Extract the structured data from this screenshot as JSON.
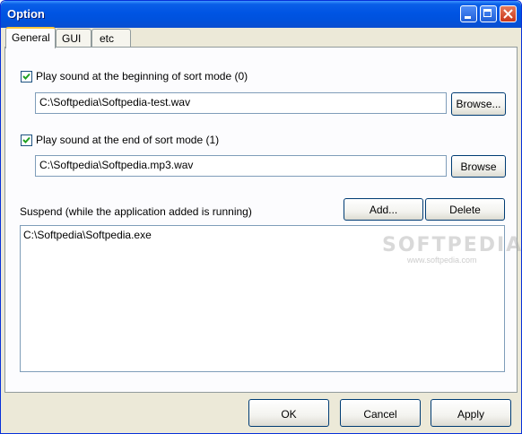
{
  "window": {
    "title": "Option"
  },
  "tabs": [
    {
      "label": "General",
      "active": true
    },
    {
      "label": "GUI",
      "active": false
    },
    {
      "label": "etc",
      "active": false
    }
  ],
  "general": {
    "sound_begin": {
      "checked": true,
      "label": "Play sound at the beginning of sort mode (0)",
      "path": "C:\\Softpedia\\Softpedia-test.wav",
      "browse_label": "Browse..."
    },
    "sound_end": {
      "checked": true,
      "label": "Play sound at the end of sort mode (1)",
      "path": "C:\\Softpedia\\Softpedia.mp3.wav",
      "browse_label": "Browse"
    },
    "suspend": {
      "label": "Suspend (while the application added is running)",
      "add_label": "Add...",
      "delete_label": "Delete",
      "items": [
        "C:\\Softpedia\\Softpedia.exe"
      ]
    }
  },
  "footer": {
    "ok_label": "OK",
    "cancel_label": "Cancel",
    "apply_label": "Apply"
  },
  "watermark": {
    "text": "SOFTPEDIA",
    "subtext": "www.softpedia.com"
  },
  "colors": {
    "titlebar": "#0054e3",
    "dialog_bg": "#ece9d8",
    "tab_highlight": "#ffc83c",
    "field_border": "#7f9db9"
  }
}
